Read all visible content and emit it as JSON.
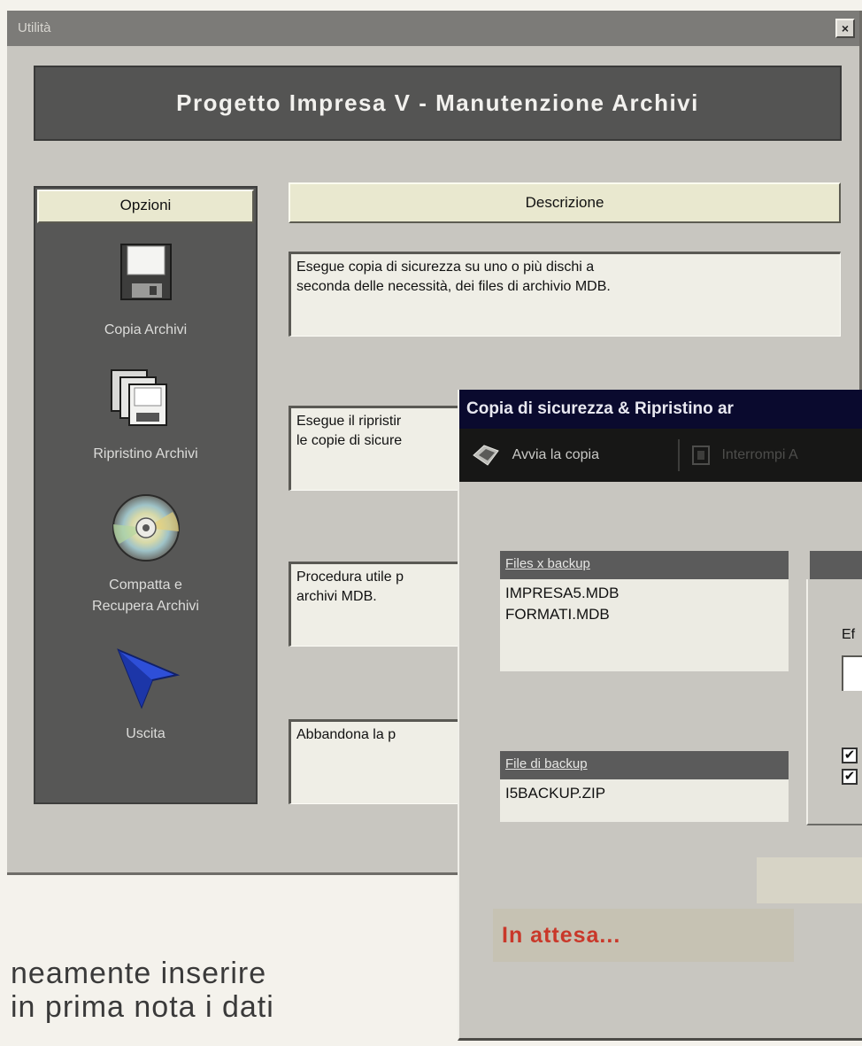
{
  "main_window": {
    "title": "Utilità",
    "close_label": "×",
    "banner_title": "Progetto Impresa V  -  Manutenzione Archivi"
  },
  "options": {
    "header": "Opzioni",
    "items": [
      {
        "label": "Copia Archivi",
        "icon": "floppy-disk-icon"
      },
      {
        "label": "Ripristino Archivi",
        "icon": "stacked-disks-icon"
      },
      {
        "label_line1": "Compatta e",
        "label_line2": "Recupera Archivi",
        "icon": "cd-icon"
      },
      {
        "label": "Uscita",
        "icon": "arrow-pointer-icon"
      }
    ]
  },
  "descriptions": {
    "header": "Descrizione",
    "items": [
      {
        "line1": "Esegue copia di sicurezza su uno o più dischi a",
        "line2": "seconda delle necessità, dei files di archivio MDB."
      },
      {
        "line1": "Esegue il ripristir",
        "line2": "le copie di sicure"
      },
      {
        "line1": "Procedura utile p",
        "line2": "archivi MDB."
      },
      {
        "line1": "Abbandona la p",
        "line2": ""
      }
    ]
  },
  "dialog": {
    "title": "Copia di sicurezza & Ripristino ar",
    "toolbar": {
      "start_copy_label": "Avvia la copia",
      "disabled_button_label": "Interrompi A"
    },
    "files_list": {
      "header": "Files x backup",
      "items": [
        "IMPRESA5.MDB",
        "FORMATI.MDB"
      ]
    },
    "backup_file": {
      "header": "File di backup",
      "value": "I5BACKUP.ZIP"
    },
    "options_partial_label": "Ef",
    "checkbox_1_checked": true,
    "checkbox_2_checked": true,
    "status": "In attesa..."
  },
  "article_text": {
    "line1": "neamente inserire",
    "line2": "in prima nota i dati"
  },
  "colors": {
    "dialog_title_bg": "#0a0a2e",
    "status_text": "#c9382a",
    "panel_bg": "#575756",
    "window_bg": "#c8c6c0"
  }
}
